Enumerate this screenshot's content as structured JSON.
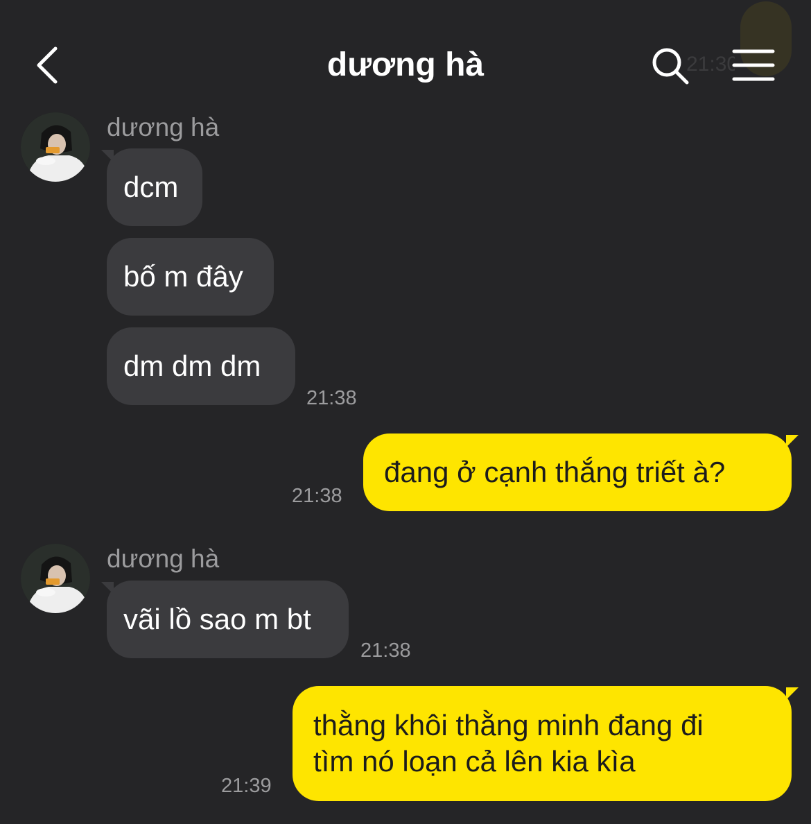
{
  "header": {
    "title": "dương hà",
    "back_icon": "chevron-left-icon",
    "search_icon": "search-icon",
    "menu_icon": "menu-icon",
    "faded_time": "21:30"
  },
  "colors": {
    "background": "#252527",
    "incoming_bubble": "#3b3b3e",
    "outgoing_bubble": "#fee500",
    "secondary_text": "#9c9c9e"
  },
  "messages": [
    {
      "sender": "dương hà",
      "direction": "incoming",
      "bubbles": [
        "dcm",
        "bố m đây",
        "dm dm dm"
      ],
      "time": "21:38"
    },
    {
      "direction": "outgoing",
      "bubbles": [
        "đang ở cạnh thắng triết à?"
      ],
      "time": "21:38"
    },
    {
      "sender": "dương hà",
      "direction": "incoming",
      "bubbles": [
        "vãi lồ sao m bt"
      ],
      "time": "21:38"
    },
    {
      "direction": "outgoing",
      "lines": [
        "thằng khôi thằng minh đang đi",
        "tìm nó loạn cả lên kia kìa"
      ],
      "time": "21:39"
    }
  ]
}
